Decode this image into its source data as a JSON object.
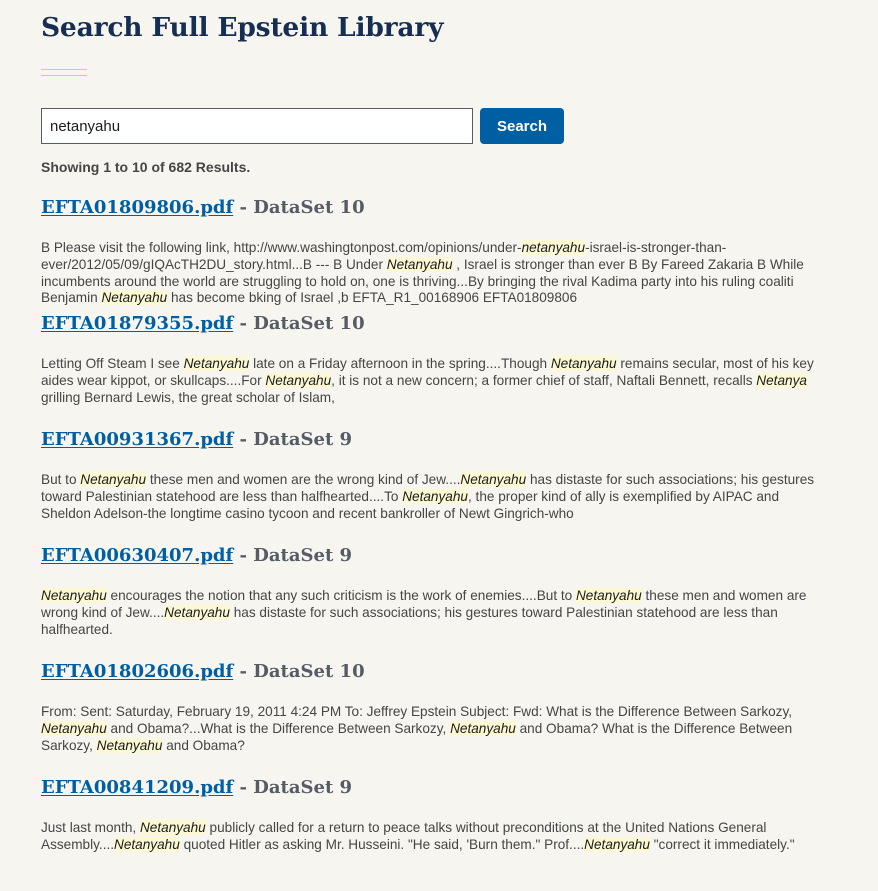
{
  "page": {
    "title": "Search Full Epstein Library"
  },
  "search": {
    "value": "netanyahu",
    "placeholder": "",
    "button_label": "Search"
  },
  "summary": "Showing 1 to 10 of 682 Results.",
  "colors": {
    "title": "#162e51",
    "accent_rule": "#f2c94c",
    "button": "#005ea2",
    "link": "#005ea2",
    "highlight": "#fdf8d4"
  },
  "results": [
    {
      "file": "EFTA01809806.pdf",
      "dataset": " - DataSet 10",
      "snippet": [
        {
          "t": "B Please visit the following link, http://www.washingtonpost.com/opinions/under-"
        },
        {
          "t": "netanyahu",
          "h": true
        },
        {
          "t": "-israel-is-stronger-than-\never/2012/05/09/gIQAcTH2DU_story.html...B --- B Under "
        },
        {
          "t": "Netanyahu",
          "h": true
        },
        {
          "t": " , Israel is stronger than ever B By Fareed Zakaria B While\nincumbents around the world are struggling to hold on, one is thriving...By bringing the rival Kadima party into his ruling coaliti\nBenjamin "
        },
        {
          "t": "Netanyahu",
          "h": true
        },
        {
          "t": " has become bking of Israel ,b EFTA_R1_00168906 EFTA01809806"
        }
      ]
    },
    {
      "file": "EFTA01879355.pdf",
      "dataset": " - DataSet 10",
      "snippet": [
        {
          "t": "Letting Off Steam I see "
        },
        {
          "t": "Netanyahu",
          "h": true
        },
        {
          "t": " late on a Friday afternoon in the spring....Though "
        },
        {
          "t": "Netanyahu",
          "h": true
        },
        {
          "t": " remains secular, most of his key\naides wear kippot, or skullcaps....For "
        },
        {
          "t": "Netanyahu",
          "h": true
        },
        {
          "t": ", it is not a new concern; a former chief of staff, Naftali Bennett, recalls "
        },
        {
          "t": "Netanya",
          "h": true
        },
        {
          "t": "\ngrilling Bernard Lewis, the great scholar of Islam,"
        }
      ]
    },
    {
      "file": "EFTA00931367.pdf",
      "dataset": " - DataSet 9",
      "snippet": [
        {
          "t": "But to "
        },
        {
          "t": "Netanyahu",
          "h": true
        },
        {
          "t": " these men and women are the wrong kind of Jew...."
        },
        {
          "t": "Netanyahu",
          "h": true
        },
        {
          "t": " has distaste for such associations; his gestures\ntoward Palestinian statehood are less than halfhearted....To "
        },
        {
          "t": "Netanyahu",
          "h": true
        },
        {
          "t": ", the proper kind of ally is exemplified by AIPAC and\nSheldon Adelson-the longtime casino tycoon and recent bankroller of Newt Gingrich-who"
        }
      ]
    },
    {
      "file": "EFTA00630407.pdf",
      "dataset": " - DataSet 9",
      "snippet": [
        {
          "t": "Netanyahu",
          "h": true
        },
        {
          "t": " encourages the notion that any such criticism is the work of enemies....But to "
        },
        {
          "t": "Netanyahu",
          "h": true
        },
        {
          "t": " these men and women are\nwrong kind of Jew...."
        },
        {
          "t": "Netanyahu",
          "h": true
        },
        {
          "t": " has distaste for such associations; his gestures toward Palestinian statehood are less than\nhalfhearted."
        }
      ]
    },
    {
      "file": "EFTA01802606.pdf",
      "dataset": " - DataSet 10",
      "snippet": [
        {
          "t": "From: Sent: Saturday, February 19, 2011 4:24 PM To: Jeffrey Epstein Subject: Fwd: What is the Difference Between Sarkozy,\n"
        },
        {
          "t": "Netanyahu",
          "h": true
        },
        {
          "t": " and Obama?...What is the Difference Between Sarkozy, "
        },
        {
          "t": "Netanyahu",
          "h": true
        },
        {
          "t": " and Obama? What is the Difference Between\nSarkozy, "
        },
        {
          "t": "Netanyahu",
          "h": true
        },
        {
          "t": " and Obama?"
        }
      ]
    },
    {
      "file": "EFTA00841209.pdf",
      "dataset": " - DataSet 9",
      "snippet": [
        {
          "t": "Just last month, "
        },
        {
          "t": "Netanyahu",
          "h": true
        },
        {
          "t": " publicly called for a return to peace talks without preconditions at the United Nations General\nAssembly...."
        },
        {
          "t": "Netanyahu",
          "h": true
        },
        {
          "t": " quoted Hitler as asking Mr. Husseini. \"He said, 'Burn them.\" Prof...."
        },
        {
          "t": "Netanyahu",
          "h": true
        },
        {
          "t": " \"correct it immediately.\""
        }
      ]
    }
  ]
}
